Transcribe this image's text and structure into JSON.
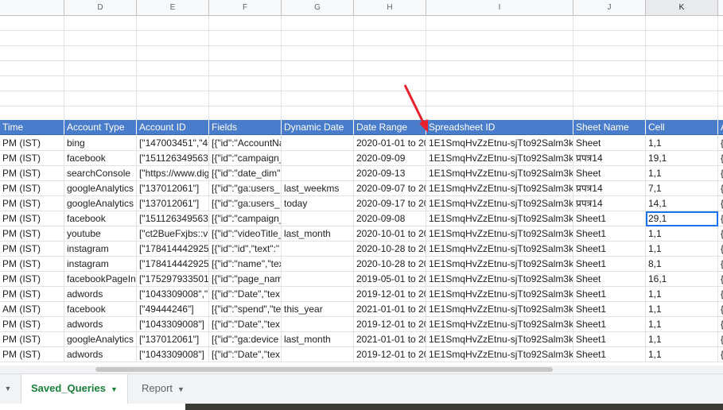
{
  "column_letters": [
    "D",
    "E",
    "F",
    "G",
    "H",
    "I",
    "J",
    "K",
    ""
  ],
  "selected_column": "K",
  "table": {
    "headers": [
      "Time",
      "Account Type",
      "Account ID",
      "Fields",
      "Dynamic Date",
      "Date Range",
      "Spreadsheet ID",
      "Sheet Name",
      "Cell",
      "A"
    ],
    "rows": [
      [
        "PM (IST)",
        "bing",
        "[\"147003451\",\"45",
        "[{\"id\":\"AccountNa",
        "",
        "2020-01-01 to 20",
        "1E1SmqHvZzEtnu-sjTto92Salm3k",
        "Sheet",
        "1,1",
        "{"
      ],
      [
        "PM (IST)",
        "facebook",
        "[\"151126349563",
        "[{\"id\":\"campaign_",
        "",
        "2020-09-09",
        "1E1SmqHvZzEtnu-sjTto92Salm3k",
        "प्रपत्र14",
        "19,1",
        "{"
      ],
      [
        "PM (IST)",
        "searchConsole",
        "[\"https://www.dig",
        "[{\"id\":\"date_dim\",",
        "",
        "2020-09-13",
        "1E1SmqHvZzEtnu-sjTto92Salm3k",
        "Sheet",
        "1,1",
        "{"
      ],
      [
        "PM (IST)",
        "googleAnalytics",
        "[\"137012061\"]",
        "[{\"id\":\"ga:users_",
        "last_weekms",
        "2020-09-07 to 20",
        "1E1SmqHvZzEtnu-sjTto92Salm3k",
        "प्रपत्र14",
        "7,1",
        "{"
      ],
      [
        "PM (IST)",
        "googleAnalytics",
        "[\"137012061\"]",
        "[{\"id\":\"ga:users_",
        "today",
        "2020-09-17 to 20",
        "1E1SmqHvZzEtnu-sjTto92Salm3k",
        "प्रपत्र14",
        "14,1",
        "{"
      ],
      [
        "PM (IST)",
        "facebook",
        "[\"151126349563",
        "[{\"id\":\"campaign_",
        "",
        "2020-09-08",
        "1E1SmqHvZzEtnu-sjTto92Salm3k",
        "Sheet1",
        "29,1",
        "{"
      ],
      [
        "PM (IST)",
        "youtube",
        "[\"ct2BueFxjbs::vi",
        "[{\"id\":\"videoTitle_",
        "last_month",
        "2020-10-01 to 20",
        "1E1SmqHvZzEtnu-sjTto92Salm3k",
        "Sheet1",
        "1,1",
        "{"
      ],
      [
        "PM (IST)",
        "instagram",
        "[\"178414442925",
        "[{\"id\":\"id\",\"text\":\"",
        "",
        "2020-10-28 to 20",
        "1E1SmqHvZzEtnu-sjTto92Salm3k",
        "Sheet1",
        "1,1",
        "{"
      ],
      [
        "PM (IST)",
        "instagram",
        "[\"178414442925",
        "[{\"id\":\"name\",\"tex",
        "",
        "2020-10-28 to 20",
        "1E1SmqHvZzEtnu-sjTto92Salm3k",
        "Sheet1",
        "8,1",
        "{"
      ],
      [
        "PM (IST)",
        "facebookPageIns",
        "[\"175297933501",
        "[{\"id\":\"page_nam",
        "",
        "2019-05-01 to 20",
        "1E1SmqHvZzEtnu-sjTto92Salm3k",
        "Sheet",
        "16,1",
        "{"
      ],
      [
        "PM (IST)",
        "adwords",
        "[\"1043309008\",\"",
        "[{\"id\":\"Date\",\"tex",
        "",
        "2019-12-01 to 20",
        "1E1SmqHvZzEtnu-sjTto92Salm3k",
        "Sheet1",
        "1,1",
        "{"
      ],
      [
        "AM (IST)",
        "facebook",
        "[\"49444246\"]",
        "[{\"id\":\"spend\",\"te",
        "this_year",
        "2021-01-01 to 20",
        "1E1SmqHvZzEtnu-sjTto92Salm3k",
        "Sheet1",
        "1,1",
        "{"
      ],
      [
        "PM (IST)",
        "adwords",
        "[\"1043309008\"]",
        "[{\"id\":\"Date\",\"tex",
        "",
        "2019-12-01 to 20",
        "1E1SmqHvZzEtnu-sjTto92Salm3k",
        "Sheet1",
        "1,1",
        "{"
      ],
      [
        "PM (IST)",
        "googleAnalytics",
        "[\"137012061\"]",
        "[{\"id\":\"ga:device",
        "last_month",
        "2021-01-01 to 20",
        "1E1SmqHvZzEtnu-sjTto92Salm3k",
        "Sheet1",
        "1,1",
        "{"
      ],
      [
        "PM (IST)",
        "adwords",
        "[\"1043309008\"]",
        "[{\"id\":\"Date\",\"tex",
        "",
        "2019-12-01 to 20",
        "1E1SmqHvZzEtnu-sjTto92Salm3k",
        "Sheet1",
        "1,1",
        "{"
      ]
    ]
  },
  "active_cell": {
    "row": 5,
    "column": "Cell",
    "value": "29,1"
  },
  "sheet_tabs": [
    {
      "label": "Saved_Queries",
      "active": true
    },
    {
      "label": "Report",
      "active": false
    }
  ],
  "colors": {
    "header_bg": "#4a7ccc",
    "header_text": "#ffffff",
    "active_tab_text": "#188038",
    "selection": "#1a73e8",
    "annotation_arrow": "#e8212c"
  },
  "icons": {
    "tab_menu": "caret-down-icon",
    "sheet_list": "caret-down-icon"
  }
}
